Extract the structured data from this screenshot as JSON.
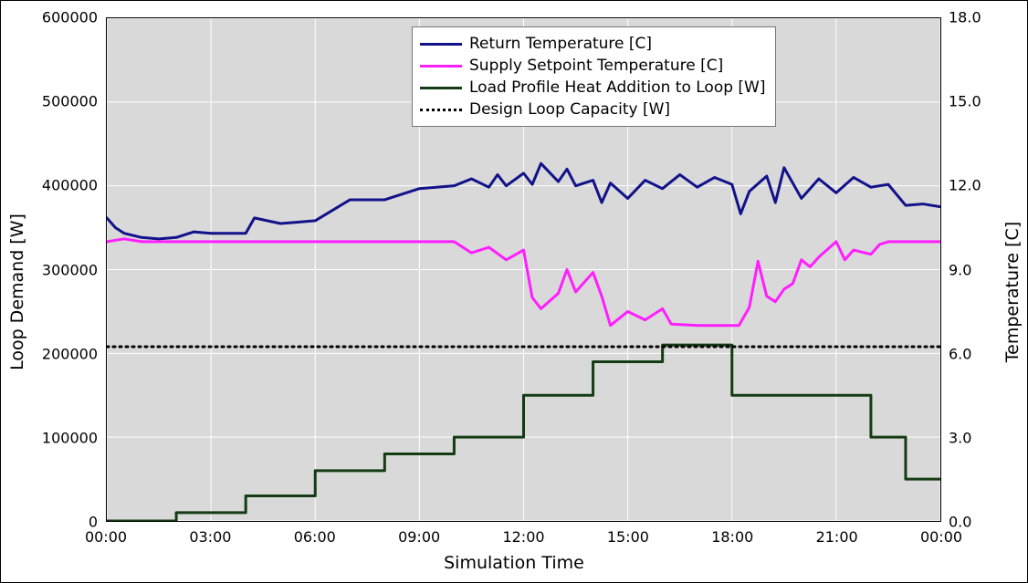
{
  "chart_data": {
    "type": "line",
    "title": "",
    "xlabel": "Simulation Time",
    "ylabel_left": "Loop Demand [W]",
    "ylabel_right": "Temperature [C]",
    "x_ticks": [
      "00:00",
      "03:00",
      "06:00",
      "09:00",
      "12:00",
      "15:00",
      "18:00",
      "21:00",
      "00:00"
    ],
    "y_left_ticks": [
      0,
      100000,
      200000,
      300000,
      400000,
      500000,
      600000
    ],
    "y_right_ticks": [
      0.0,
      3.0,
      6.0,
      9.0,
      12.0,
      15.0,
      18.0
    ],
    "y_left_range": [
      0,
      600000
    ],
    "y_right_range": [
      0.0,
      18.0
    ],
    "x_range_hours": [
      0,
      24
    ],
    "series": [
      {
        "name": "Return Temperature [C]",
        "axis": "right",
        "color": "#12128a",
        "style": "solid",
        "x": [
          0.0,
          0.25,
          0.5,
          1.0,
          1.5,
          2.0,
          2.5,
          3.0,
          4.0,
          4.25,
          5.0,
          5.5,
          6.0,
          7.0,
          8.0,
          8.5,
          9.0,
          10.0,
          10.5,
          11.0,
          11.25,
          11.5,
          12.0,
          12.25,
          12.5,
          13.0,
          13.25,
          13.5,
          14.0,
          14.25,
          14.5,
          15.0,
          15.5,
          16.0,
          16.5,
          17.0,
          17.5,
          18.0,
          18.25,
          18.5,
          19.0,
          19.25,
          19.5,
          20.0,
          20.5,
          21.0,
          21.5,
          22.0,
          22.5,
          23.0,
          23.5,
          24.0
        ],
        "y": [
          10.85,
          10.5,
          10.3,
          10.15,
          10.1,
          10.15,
          10.35,
          10.3,
          10.3,
          10.85,
          10.65,
          10.7,
          10.75,
          11.5,
          11.5,
          11.7,
          11.9,
          12.0,
          12.25,
          11.95,
          12.4,
          12.0,
          12.45,
          12.05,
          12.8,
          12.15,
          12.6,
          12.0,
          12.2,
          11.4,
          12.1,
          11.55,
          12.2,
          11.9,
          12.4,
          11.95,
          12.3,
          12.05,
          11.0,
          11.8,
          12.35,
          11.4,
          12.65,
          11.55,
          12.25,
          11.75,
          12.3,
          11.95,
          12.05,
          11.3,
          11.35,
          11.25
        ],
        "unit": "C"
      },
      {
        "name": "Supply Setpoint Temperature [C]",
        "axis": "right",
        "color": "#ff1eff",
        "style": "solid",
        "x": [
          0.0,
          0.5,
          1.0,
          4.0,
          8.0,
          10.0,
          10.5,
          11.0,
          11.5,
          12.0,
          12.25,
          12.5,
          13.0,
          13.25,
          13.5,
          14.0,
          14.25,
          14.5,
          15.0,
          15.5,
          16.0,
          16.25,
          17.0,
          17.5,
          18.0,
          18.2,
          18.5,
          18.75,
          19.0,
          19.25,
          19.5,
          19.75,
          20.0,
          20.25,
          20.5,
          21.0,
          21.25,
          21.5,
          22.0,
          22.25,
          22.5,
          23.0,
          24.0
        ],
        "y": [
          10.0,
          10.1,
          10.0,
          10.0,
          10.0,
          10.0,
          9.6,
          9.8,
          9.35,
          9.7,
          8.0,
          7.6,
          8.15,
          9.0,
          8.2,
          8.9,
          8.05,
          7.0,
          7.5,
          7.2,
          7.6,
          7.05,
          7.0,
          7.0,
          7.0,
          7.0,
          7.65,
          9.3,
          8.05,
          7.85,
          8.3,
          8.5,
          9.35,
          9.1,
          9.45,
          10.0,
          9.35,
          9.7,
          9.55,
          9.9,
          10.0,
          10.0,
          10.0
        ],
        "unit": "C"
      },
      {
        "name": "Load Profile Heat Addition to Loop [W]",
        "axis": "left",
        "color": "#143c14",
        "style": "solid",
        "step": true,
        "x": [
          0,
          2,
          3,
          4,
          5,
          6,
          8,
          10,
          12,
          14,
          16,
          18,
          20,
          22,
          23,
          24
        ],
        "y": [
          0,
          10000,
          10000,
          30000,
          30000,
          60000,
          80000,
          100000,
          150000,
          190000,
          210000,
          150000,
          150000,
          100000,
          50000,
          50000
        ],
        "unit": "W"
      },
      {
        "name": "Design Loop Capacity [W]",
        "axis": "left",
        "color": "#000000",
        "style": "dotted",
        "x": [
          0,
          24
        ],
        "y": [
          208000,
          208000
        ],
        "unit": "W"
      }
    ],
    "legend_position": "upper center",
    "grid": true
  },
  "colors": {
    "return_temp": "#12128a",
    "supply_setpoint": "#ff1eff",
    "load_profile": "#143c14",
    "design_capacity": "#000000",
    "plot_bg": "#d9d9d9",
    "grid": "#ffffff"
  }
}
